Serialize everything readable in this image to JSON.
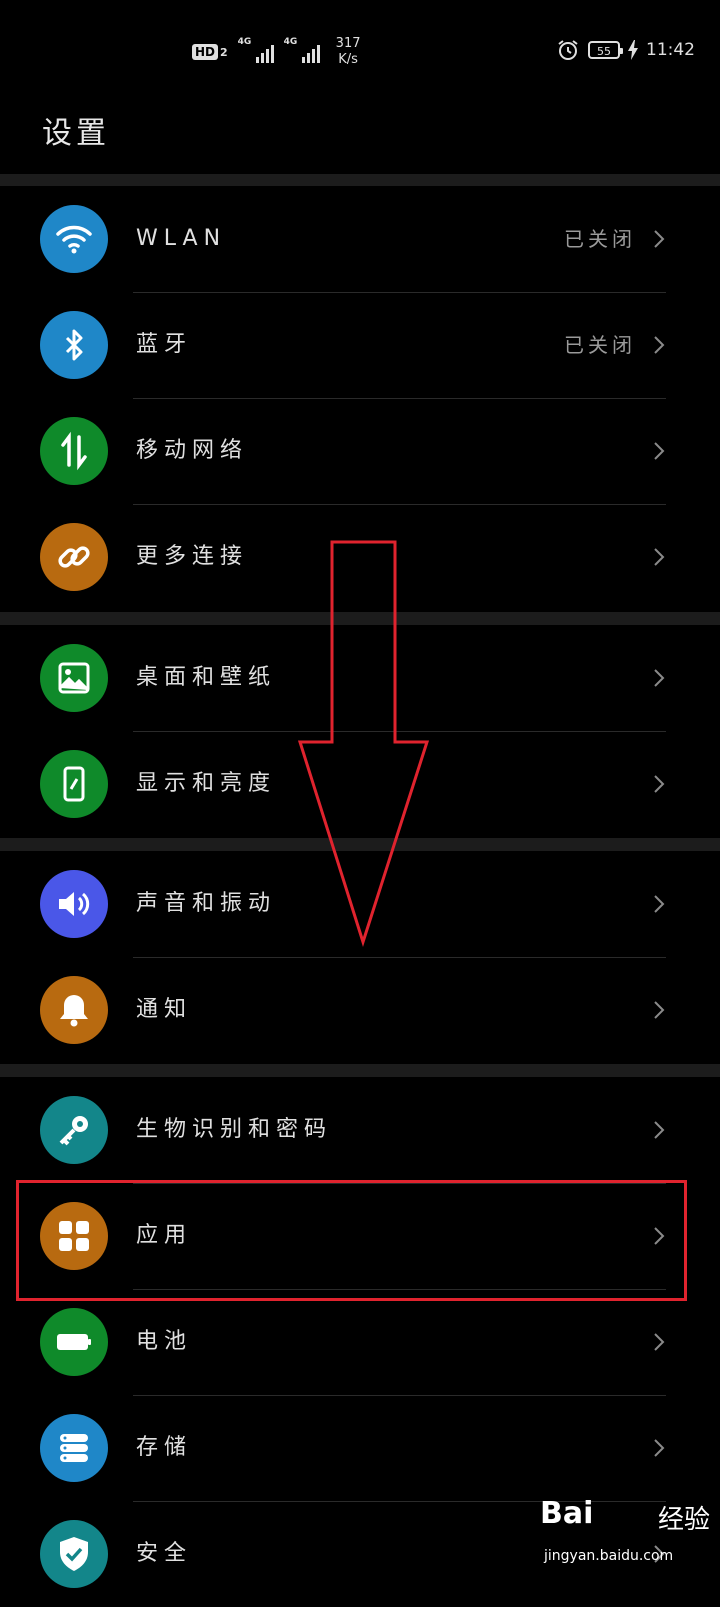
{
  "status_bar": {
    "hd_label": "HD",
    "hd_sub": "2",
    "network1": "4G",
    "network2": "4G",
    "speed_value": "317",
    "speed_unit": "K/s",
    "battery_level": "55",
    "time": "11:42"
  },
  "header": {
    "title": "设置"
  },
  "settings": [
    {
      "label": "WLAN",
      "value": "已关闭",
      "icon": "wifi-icon",
      "color": "#1f87c8"
    },
    {
      "label": "蓝牙",
      "value": "已关闭",
      "icon": "bluetooth-icon",
      "color": "#1f87c8"
    },
    {
      "label": "移动网络",
      "value": "",
      "icon": "mobile-data-icon",
      "color": "#0f8a2a"
    },
    {
      "label": "更多连接",
      "value": "",
      "icon": "link-icon",
      "color": "#b86a10"
    },
    {
      "label": "桌面和壁纸",
      "value": "",
      "icon": "wallpaper-icon",
      "color": "#0f8a2a"
    },
    {
      "label": "显示和亮度",
      "value": "",
      "icon": "display-icon",
      "color": "#0f8a2a"
    },
    {
      "label": "声音和振动",
      "value": "",
      "icon": "speaker-icon",
      "color": "#4a57e8"
    },
    {
      "label": "通知",
      "value": "",
      "icon": "bell-icon",
      "color": "#b86a10"
    },
    {
      "label": "生物识别和密码",
      "value": "",
      "icon": "key-icon",
      "color": "#13868a"
    },
    {
      "label": "应用",
      "value": "",
      "icon": "apps-grid-icon",
      "color": "#b86a10"
    },
    {
      "label": "电池",
      "value": "",
      "icon": "battery-icon",
      "color": "#0f8a2a"
    },
    {
      "label": "存储",
      "value": "",
      "icon": "storage-icon",
      "color": "#1f87c8"
    },
    {
      "label": "安全",
      "value": "",
      "icon": "shield-icon",
      "color": "#13868a"
    }
  ],
  "watermark": {
    "brand": "Bai",
    "brand_cn": "经验",
    "url": "jingyan.baidu.com"
  },
  "colors": {
    "annotation": "#e0232e",
    "background": "#000000"
  }
}
